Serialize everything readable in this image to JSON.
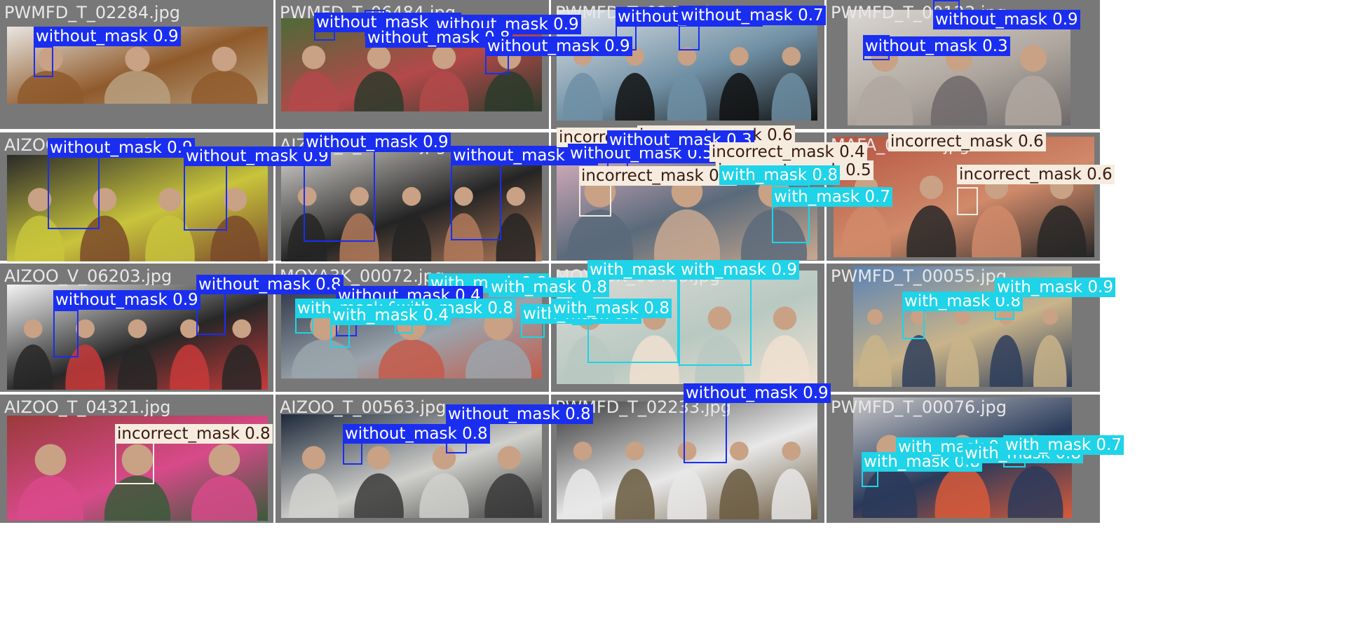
{
  "colors": {
    "without_mask": "#1a2ef0",
    "with_mask": "#1fd3e8",
    "incorrect_mask": "#f5ecdf",
    "tile_bg": "#787878"
  },
  "tiles": [
    {
      "filename": "PWMFD_T_02284.jpg",
      "scene": "workers",
      "detections": [
        {
          "cls": "without_mask",
          "conf": "0.9"
        }
      ]
    },
    {
      "filename": "PWMFD_T_06484.jpg",
      "scene": "group",
      "detections": [
        {
          "cls": "without_mask",
          "conf": "0.8"
        },
        {
          "cls": "without_mask",
          "conf": "0.9"
        },
        {
          "cls": "without_mask",
          "conf": "0.8"
        },
        {
          "cls": "without_mask",
          "conf": "0.9"
        }
      ]
    },
    {
      "filename": "PWMFD_T_02484.jpg",
      "scene": "doctor",
      "detections": [
        {
          "cls": "without_mask",
          "conf": "0.8"
        },
        {
          "cls": "without_mask",
          "conf": "0.7"
        }
      ]
    },
    {
      "filename": "PWMFD_T_00123.jpg",
      "scene": "street",
      "detections": [
        {
          "cls": "without_mask",
          "conf": "0.9"
        },
        {
          "cls": "without_mask",
          "conf": "0.3"
        }
      ]
    },
    {
      "filename": "AIZOO_T_00143.jpg",
      "scene": "portraits",
      "detections": [
        {
          "cls": "without_mask",
          "conf": "0.9"
        },
        {
          "cls": "without_mask",
          "conf": "0.9"
        }
      ]
    },
    {
      "filename": "AIZOO_T_00212.jpg",
      "scene": "portraits2",
      "detections": [
        {
          "cls": "without_mask",
          "conf": "0.9"
        },
        {
          "cls": "without_mask",
          "conf": "0.9"
        }
      ]
    },
    {
      "filename": "MAFA_01432.jpg",
      "scene": "kids",
      "detections": [
        {
          "cls": "incorrect_mask",
          "conf": "0.6"
        },
        {
          "cls": "incorrect_mask",
          "conf": "0.6"
        },
        {
          "cls": "without_mask",
          "conf": "0.5"
        },
        {
          "cls": "without_mask",
          "conf": "0.3"
        },
        {
          "cls": "incorrect_mask",
          "conf": "0.4"
        },
        {
          "cls": "incorrect_mask",
          "conf": "0.5"
        },
        {
          "cls": "incorrect_mask",
          "conf": "0.4"
        },
        {
          "cls": "with_mask",
          "conf": "0.8"
        },
        {
          "cls": "with_mask",
          "conf": "0.7"
        }
      ]
    },
    {
      "filename": "MAFA_01868.jpg",
      "scene": "fans",
      "detections": [
        {
          "cls": "incorrect_mask",
          "conf": "0.6"
        },
        {
          "cls": "incorrect_mask",
          "conf": "0.6"
        }
      ]
    },
    {
      "filename": "AIZOO_V_06203.jpg",
      "scene": "event",
      "detections": [
        {
          "cls": "without_mask",
          "conf": "0.8"
        },
        {
          "cls": "without_mask",
          "conf": "0.9"
        }
      ]
    },
    {
      "filename": "MOXA3K_00072.jpg",
      "scene": "crowd",
      "detections": [
        {
          "cls": "with_mask",
          "conf": "0.8"
        },
        {
          "cls": "with_mask",
          "conf": "0.8"
        },
        {
          "cls": "without_mask",
          "conf": "0.4"
        },
        {
          "cls": "with_mask",
          "conf": "0.8"
        },
        {
          "cls": "with_mask",
          "conf": "0.8"
        },
        {
          "cls": "with_mask",
          "conf": "0.8"
        },
        {
          "cls": "with_mask",
          "conf": "0.4"
        }
      ]
    },
    {
      "filename": "MOXA3K_00408.jpg",
      "scene": "children",
      "detections": [
        {
          "cls": "with_mask",
          "conf": "0.8"
        },
        {
          "cls": "with_mask",
          "conf": "0.9"
        },
        {
          "cls": "with_mask",
          "conf": "0.8"
        }
      ]
    },
    {
      "filename": "PWMFD_T_00055.jpg",
      "scene": "meeting",
      "detections": [
        {
          "cls": "with_mask",
          "conf": "0.8"
        },
        {
          "cls": "with_mask",
          "conf": "0.9"
        }
      ]
    },
    {
      "filename": "AIZOO_T_04321.jpg",
      "scene": "tvshow",
      "detections": [
        {
          "cls": "incorrect_mask",
          "conf": "0.8"
        }
      ]
    },
    {
      "filename": "AIZOO_T_00563.jpg",
      "scene": "night",
      "detections": [
        {
          "cls": "without_mask",
          "conf": "0.8"
        },
        {
          "cls": "without_mask",
          "conf": "0.8"
        }
      ]
    },
    {
      "filename": "PWMFD_T_02233.jpg",
      "scene": "waitress",
      "detections": [
        {
          "cls": "without_mask",
          "conf": "0.9"
        }
      ]
    },
    {
      "filename": "PWMFD_T_00076.jpg",
      "scene": "news",
      "detections": [
        {
          "cls": "with_mask",
          "conf": "0.8"
        },
        {
          "cls": "with_mask",
          "conf": "0.7"
        },
        {
          "cls": "with_mask",
          "conf": "0.8"
        },
        {
          "cls": "with_mask",
          "conf": "0.7"
        }
      ]
    }
  ]
}
